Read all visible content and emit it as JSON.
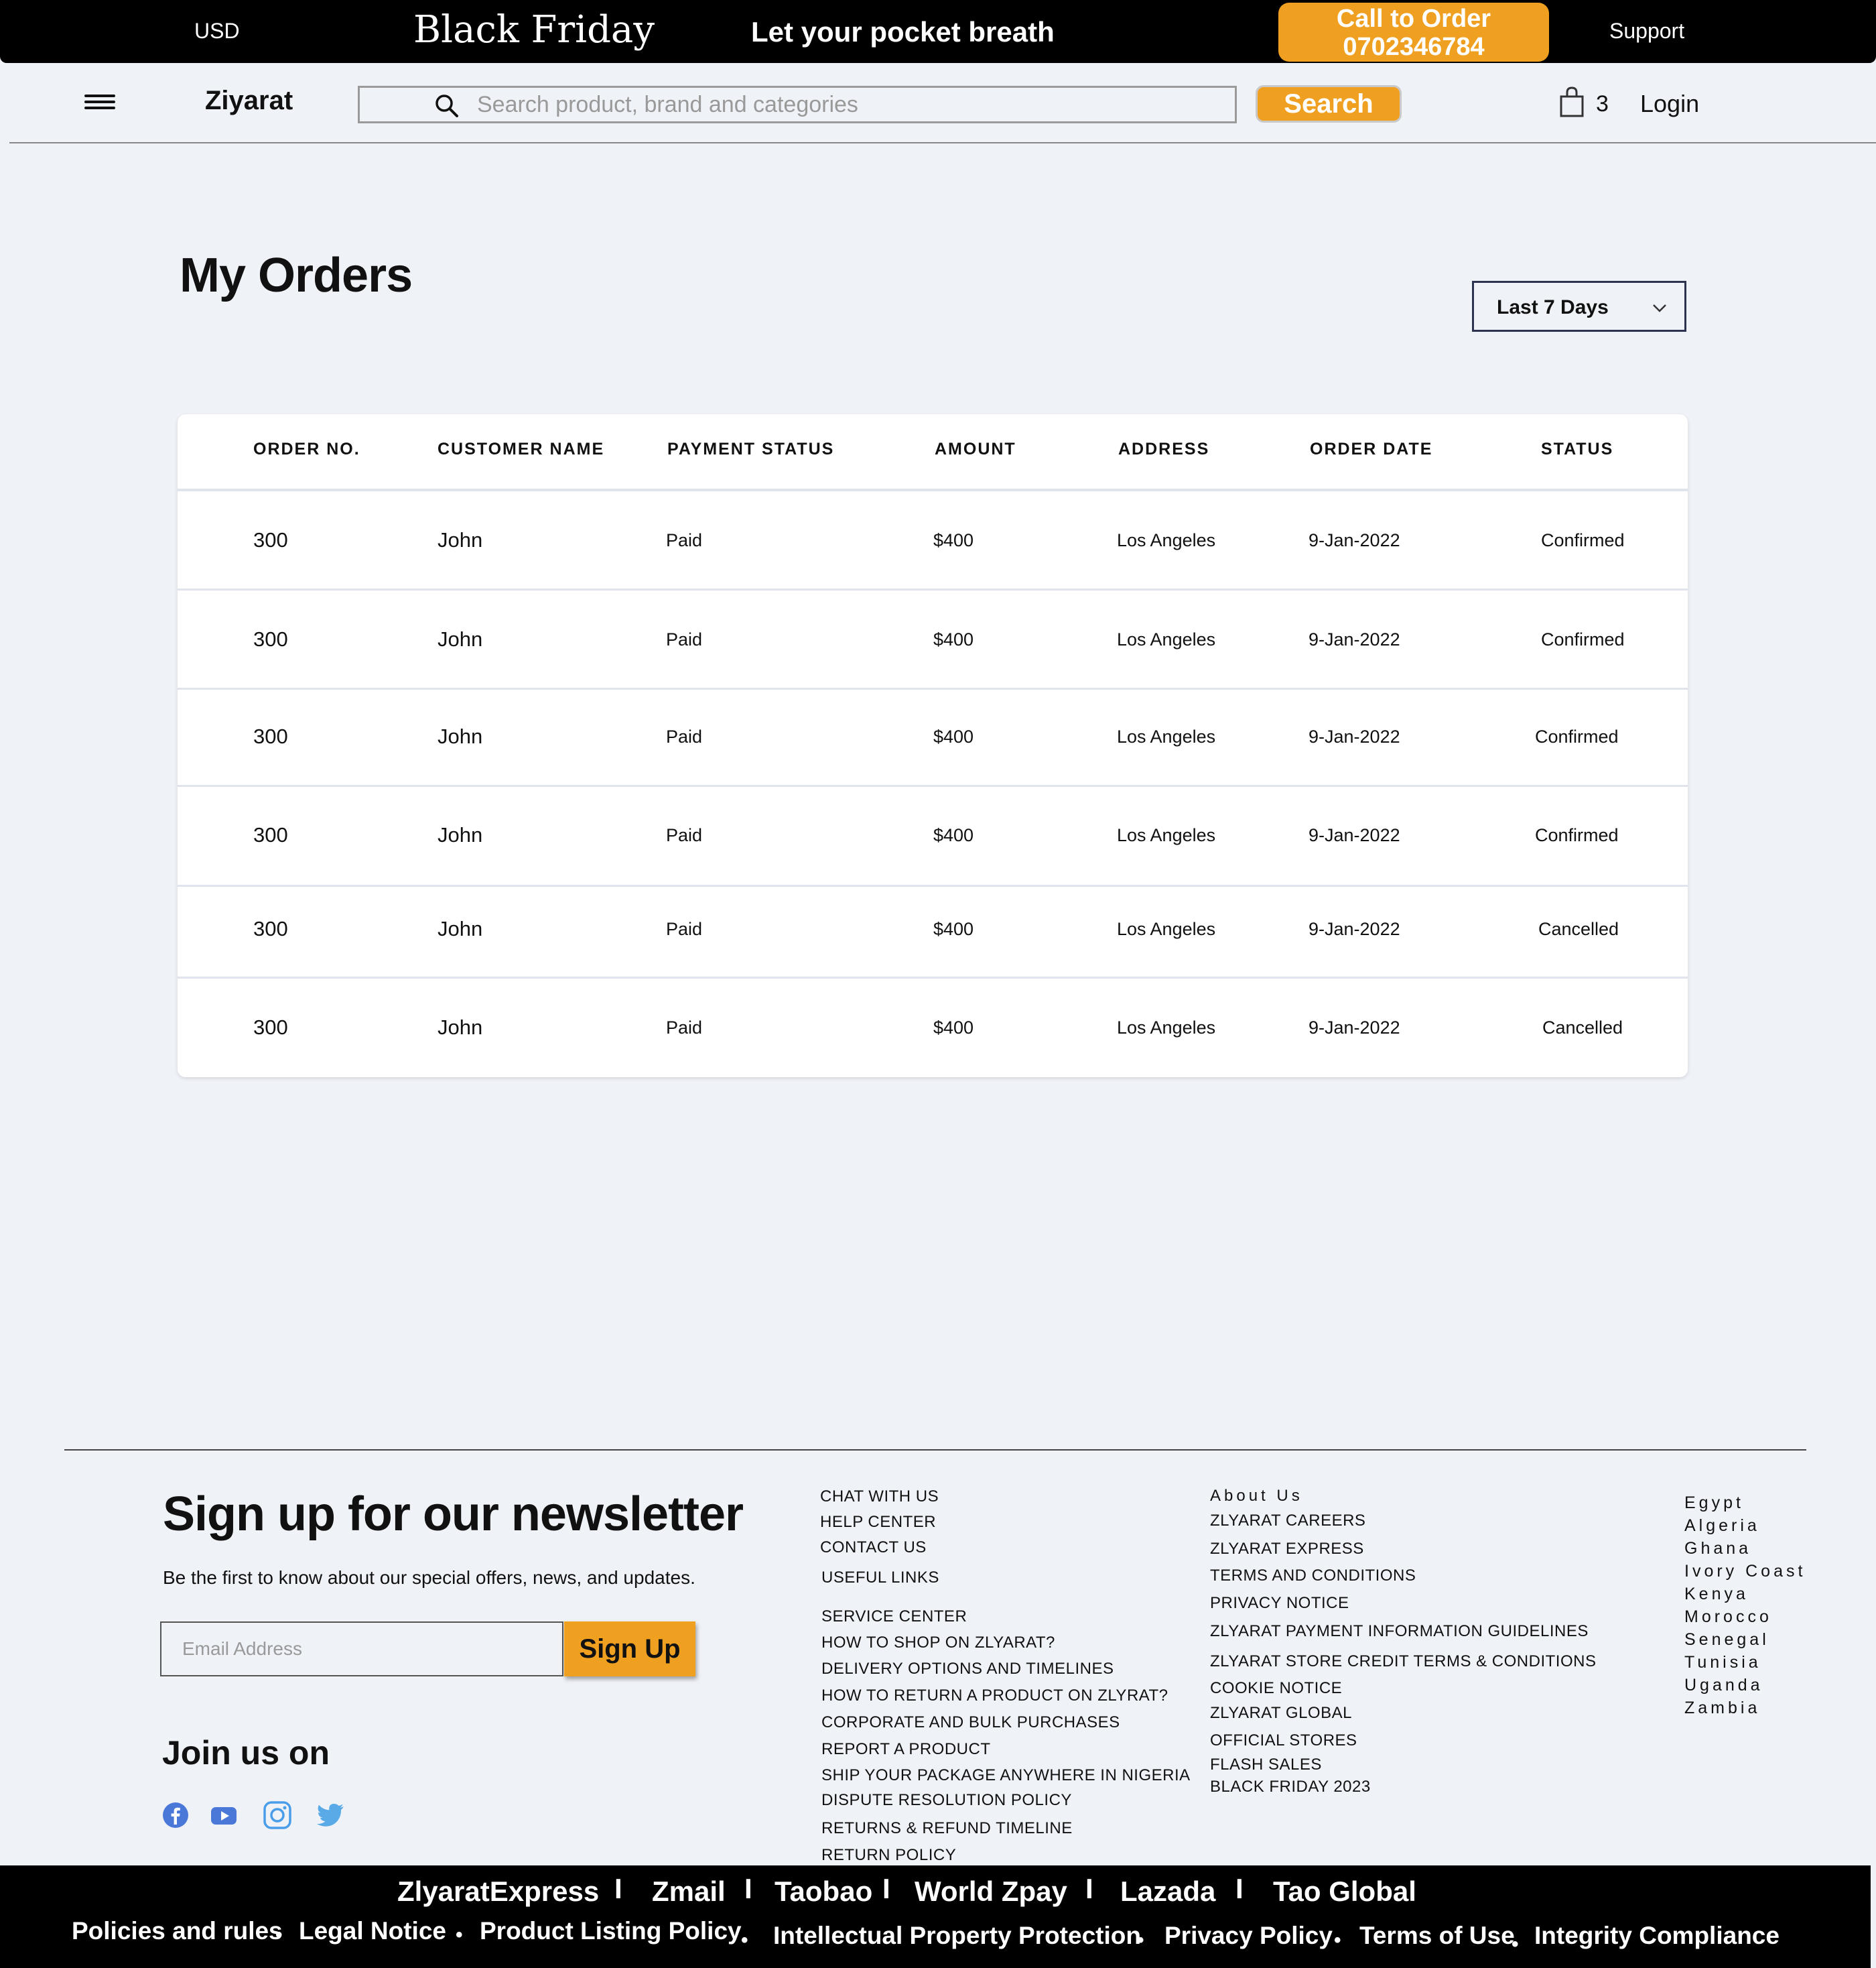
{
  "promo": {
    "currency": "USD",
    "event": "Black Friday",
    "tagline": "Let your pocket breath",
    "call_line1": "Call to Order",
    "call_line2": "0702346784",
    "support": "Support"
  },
  "header": {
    "logo": "Ziyarat",
    "search_placeholder": "Search product, brand and categories",
    "search_button": "Search",
    "cart_count": "3",
    "login": "Login"
  },
  "page": {
    "title": "My Orders",
    "filter": "Last 7 Days"
  },
  "table": {
    "headers": [
      "ORDER NO.",
      "CUSTOMER NAME",
      "PAYMENT STATUS",
      "AMOUNT",
      "ADDRESS",
      "ORDER DATE",
      "STATUS"
    ],
    "rows": [
      [
        "300",
        "John",
        "Paid",
        "$400",
        "Los Angeles",
        "9-Jan-2022",
        "Confirmed"
      ],
      [
        "300",
        "John",
        "Paid",
        "$400",
        "Los Angeles",
        "9-Jan-2022",
        "Confirmed"
      ],
      [
        "300",
        "John",
        "Paid",
        "$400",
        "Los Angeles",
        "9-Jan-2022",
        "Confirmed"
      ],
      [
        "300",
        "John",
        "Paid",
        "$400",
        "Los Angeles",
        "9-Jan-2022",
        "Confirmed"
      ],
      [
        "300",
        "John",
        "Paid",
        "$400",
        "Los Angeles",
        "9-Jan-2022",
        "Cancelled"
      ],
      [
        "300",
        "John",
        "Paid",
        "$400",
        "Los Angeles",
        "9-Jan-2022",
        "Cancelled"
      ]
    ]
  },
  "newsletter": {
    "title": "Sign up for our newsletter",
    "subtitle": "Be the first to know about our special offers, news, and updates.",
    "email_placeholder": "Email Address",
    "signup": "Sign Up",
    "join": "Join us on",
    "socials": [
      "facebook-icon",
      "youtube-icon",
      "instagram-icon",
      "twitter-icon"
    ]
  },
  "footer": {
    "col1": [
      "CHAT WITH US",
      "HELP CENTER",
      "CONTACT US",
      "USEFUL LINKS",
      "SERVICE CENTER",
      "HOW TO SHOP ON  ZLYARAT?",
      "DELIVERY OPTIONS AND TIMELINES",
      "HOW TO RETURN A PRODUCT ON ZLYRAT?",
      "CORPORATE AND BULK PURCHASES",
      "REPORT A PRODUCT",
      "SHIP YOUR PACKAGE ANYWHERE IN NIGERIA",
      "DISPUTE RESOLUTION POLICY",
      "RETURNS & REFUND TIMELINE",
      "RETURN POLICY"
    ],
    "col2": [
      "About Us",
      "ZLYARAT CAREERS",
      "ZLYARAT EXPRESS",
      "TERMS AND CONDITIONS",
      "PRIVACY NOTICE",
      "ZLYARAT PAYMENT INFORMATION GUIDELINES",
      "ZLYARAT STORE CREDIT TERMS & CONDITIONS",
      "COOKIE NOTICE",
      "ZLYARAT GLOBAL",
      "OFFICIAL STORES",
      "FLASH SALES",
      "BLACK FRIDAY 2023"
    ],
    "countries": [
      "Egypt",
      "Algeria",
      "Ghana",
      "Ivory Coast",
      "Kenya",
      "Morocco",
      "Senegal",
      "Tunisia",
      "Uganda",
      "Zambia"
    ]
  },
  "bottom": {
    "brands": [
      "ZlyaratExpress",
      "Zmail",
      "Taobao",
      "World Zpay",
      "Lazada",
      "Tao Global"
    ],
    "policies": [
      "Policies and rules",
      "Legal Notice",
      "Product Listing Policy",
      "Intellectual Property Protection",
      "Privacy Policy",
      "Terms of Use",
      "Integrity Compliance"
    ]
  },
  "colors": {
    "accent": "#f0a020",
    "bar": "#000000",
    "page_bg": "#eff2f7"
  }
}
